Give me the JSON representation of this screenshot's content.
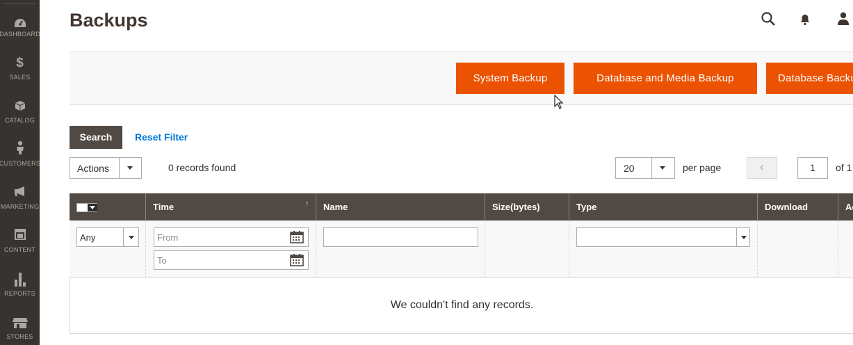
{
  "sidebar": {
    "items": [
      {
        "label": "DASHBOARD",
        "icon": "dashboard-icon"
      },
      {
        "label": "SALES",
        "icon": "dollar-icon"
      },
      {
        "label": "CATALOG",
        "icon": "box-icon"
      },
      {
        "label": "CUSTOMERS",
        "icon": "person-icon"
      },
      {
        "label": "MARKETING",
        "icon": "megaphone-icon"
      },
      {
        "label": "CONTENT",
        "icon": "layout-icon"
      },
      {
        "label": "REPORTS",
        "icon": "bar-chart-icon"
      },
      {
        "label": "STORES",
        "icon": "store-icon"
      }
    ]
  },
  "header": {
    "title": "Backups"
  },
  "action_buttons": {
    "system_backup": "System Backup",
    "database_media_backup": "Database and Media Backup",
    "database_backup": "Database Backup"
  },
  "filters": {
    "search_label": "Search",
    "reset_label": "Reset Filter"
  },
  "toolbar": {
    "actions_label": "Actions",
    "records_found": "0 records found",
    "per_page_value": "20",
    "per_page_label": "per page",
    "prev_label": "‹",
    "current_page": "1",
    "of_total": "of 1"
  },
  "grid": {
    "columns": [
      "Time",
      "Name",
      "Size(bytes)",
      "Type",
      "Download",
      "Action"
    ],
    "sort_indicator": "↑",
    "filter": {
      "any": "Any",
      "from_placeholder": "From",
      "to_placeholder": "To",
      "name_value": "",
      "type_value": ""
    },
    "empty_message": "We couldn't find any records."
  },
  "colors": {
    "sidebar_bg": "#373330",
    "accent": "#eb5202",
    "grid_header_bg": "#514943",
    "link": "#007bdb"
  }
}
